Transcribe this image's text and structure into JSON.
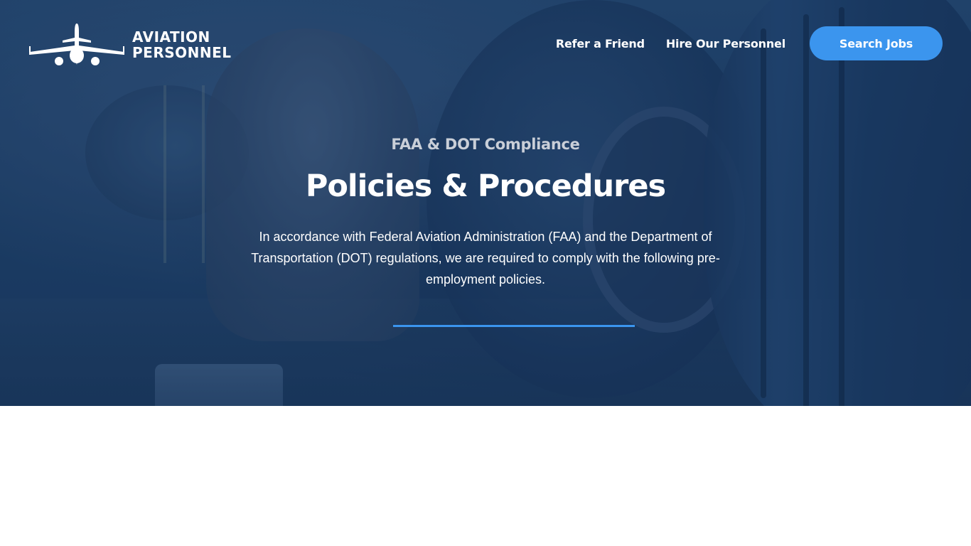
{
  "logo": {
    "line1": "AVIATION",
    "line2": "PERSONNEL"
  },
  "nav": {
    "links": [
      "Refer a Friend",
      "Hire Our Personnel"
    ],
    "cta": "Search Jobs"
  },
  "hero": {
    "eyebrow": "FAA & DOT Compliance",
    "title": "Policies & Procedures",
    "description": "In accordance with Federal Aviation Administration (FAA) and the Department of Transportation (DOT) regulations, we are required to comply with the following pre-employment policies."
  },
  "colors": {
    "accent": "#3b95ee",
    "hero_overlay": "#1d3f66",
    "eyebrow_text": "#c9cfd8",
    "page_background": "#ffffff"
  },
  "icons": [
    "airplane-logo-icon"
  ]
}
